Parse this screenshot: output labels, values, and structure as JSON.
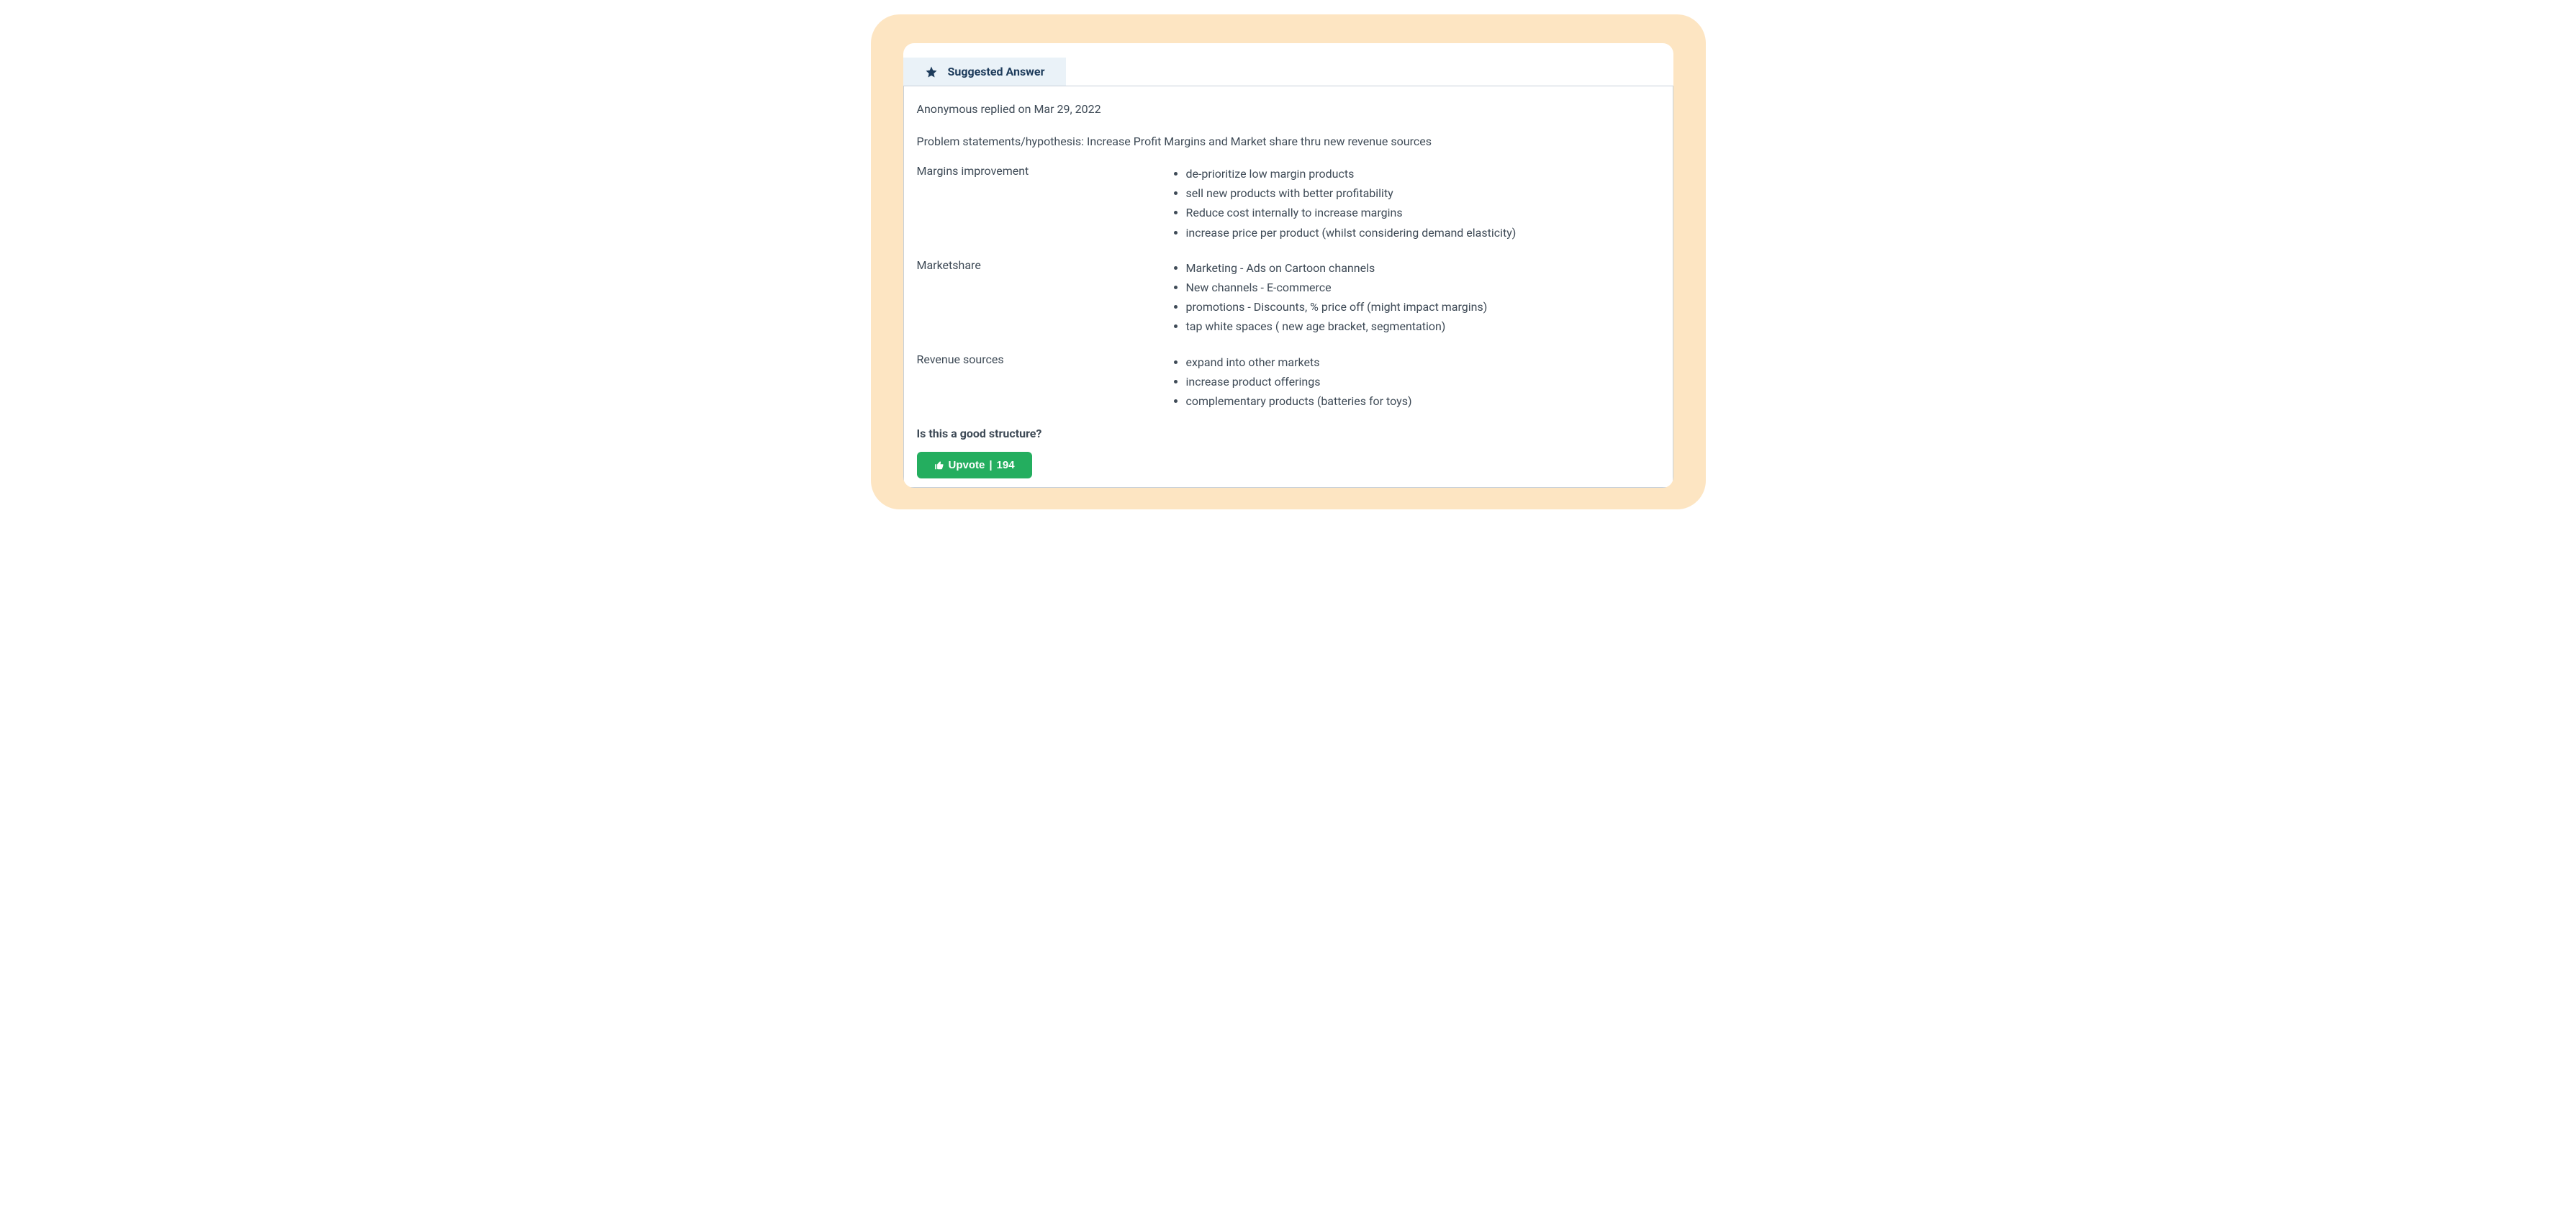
{
  "tab": {
    "label": "Suggested Answer"
  },
  "reply": {
    "author": "Anonymous",
    "verb": "replied on",
    "date": "Mar 29, 2022"
  },
  "problem_statement": "Problem statements/hypothesis: Increase Profit Margins and Market share thru new revenue sources",
  "sections": [
    {
      "label": "Margins improvement",
      "items": [
        "de-prioritize low margin products",
        "sell new products with better profitability",
        "Reduce cost internally to increase margins",
        "increase price per product (whilst considering demand elasticity)"
      ]
    },
    {
      "label": "Marketshare",
      "items": [
        "Marketing - Ads on Cartoon channels",
        "New channels - E-commerce",
        "promotions - Discounts, % price off (might impact margins)",
        "tap white spaces ( new age bracket, segmentation)"
      ]
    },
    {
      "label": "Revenue sources",
      "items": [
        "expand into other markets",
        "increase product offerings",
        "complementary products (batteries for toys)"
      ]
    }
  ],
  "question": "Is this a good structure?",
  "upvote": {
    "label": "Upvote",
    "separator": " | ",
    "count": "194"
  }
}
